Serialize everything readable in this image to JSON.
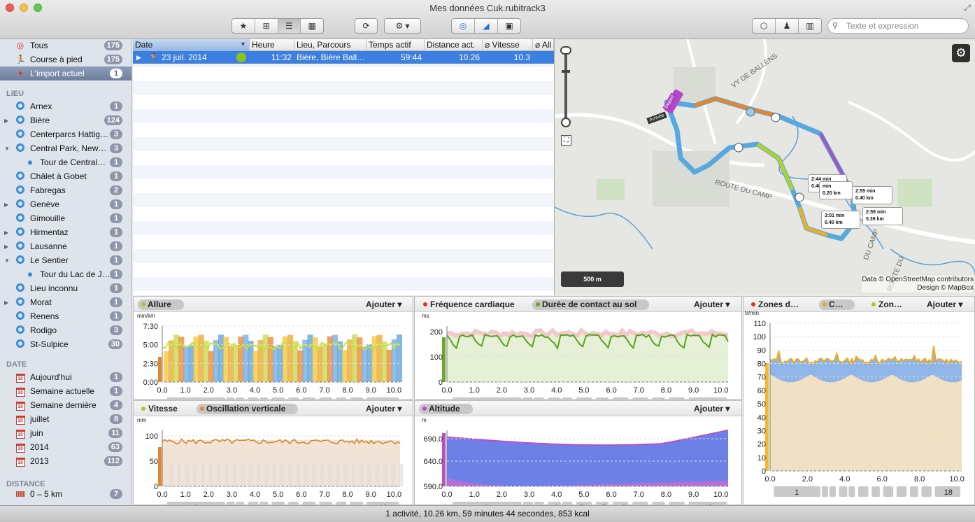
{
  "window": {
    "title": "Mes données Cuk.rubitrack3"
  },
  "toolbar": {
    "search_placeholder": "Texte et expression",
    "group1": [
      "★",
      "⊞",
      "☰",
      "▦"
    ],
    "group2": [
      "⟳"
    ],
    "group3": [
      "⚙ ▾"
    ],
    "group4": [
      "◎",
      "◢",
      "▣"
    ],
    "group5": [
      "⬡",
      "♟",
      "▥"
    ]
  },
  "sidebar": {
    "top": [
      {
        "label": "Tous",
        "count": "175",
        "icon": "◎",
        "color": "#e0342c"
      },
      {
        "label": "Course à pied",
        "count": "175",
        "icon": "🏃",
        "color": "#111"
      },
      {
        "label": "L'import actuel",
        "count": "1",
        "icon": "✦",
        "color": "#e0342c"
      }
    ],
    "lieu_header": "LIEU",
    "lieu": [
      {
        "label": "Arnex",
        "count": "1"
      },
      {
        "label": "Bière",
        "count": "124",
        "tri": "▶"
      },
      {
        "label": "Centerparcs Hattig…",
        "count": "3"
      },
      {
        "label": "Central Park, New…",
        "count": "3",
        "tri": "▼"
      },
      {
        "label": "Tour de Central…",
        "count": "1",
        "child": true
      },
      {
        "label": "Châlet à Gobet",
        "count": "1"
      },
      {
        "label": "Fabregas",
        "count": "2"
      },
      {
        "label": "Genève",
        "count": "1",
        "tri": "▶"
      },
      {
        "label": "Gimouille",
        "count": "1"
      },
      {
        "label": "Hirmentaz",
        "count": "1",
        "tri": "▶"
      },
      {
        "label": "Lausanne",
        "count": "1",
        "tri": "▶"
      },
      {
        "label": "Le Sentier",
        "count": "1",
        "tri": "▼"
      },
      {
        "label": "Tour du Lac de J…",
        "count": "1",
        "child": true
      },
      {
        "label": "Lieu inconnu",
        "count": "1"
      },
      {
        "label": "Morat",
        "count": "1",
        "tri": "▶"
      },
      {
        "label": "Renens",
        "count": "1"
      },
      {
        "label": "Rodigo",
        "count": "3"
      },
      {
        "label": "St-Sulpice",
        "count": "30"
      }
    ],
    "date_header": "DATE",
    "date": [
      {
        "label": "Aujourd'hui",
        "count": "1"
      },
      {
        "label": "Semaine actuelle",
        "count": "1"
      },
      {
        "label": "Semaine dernière",
        "count": "4"
      },
      {
        "label": "juillet",
        "count": "8"
      },
      {
        "label": "juin",
        "count": "11"
      },
      {
        "label": "2014",
        "count": "63"
      },
      {
        "label": "2013",
        "count": "112"
      }
    ],
    "distance_header": "DISTANCE",
    "distance": [
      {
        "label": "0 – 5 km",
        "count": "7"
      }
    ]
  },
  "table": {
    "columns": [
      "Date",
      "Heure",
      "Lieu, Parcours",
      "Temps actif",
      "Distance act.",
      "⌀ Vitesse",
      "⌀ All"
    ],
    "row": {
      "date": "23 juil. 2014",
      "heure": "11:32",
      "lieu": "Bière, Bière Ball…",
      "temps": "59:44",
      "distance": "10.26",
      "vitesse": "10.3"
    }
  },
  "map": {
    "labels": [
      "VY DE BALLENS",
      "ROUTE DU CAMP",
      "DU CAMP",
      "ROUTE DU"
    ],
    "start": "Départ",
    "end": "Arrivée",
    "scale": "500 m",
    "attrib1": "Data © OpenStreetMap contributors",
    "attrib2": "Design © MapBox",
    "splits": [
      {
        "t": "2:44 min",
        "d": "0.40 km"
      },
      {
        "t": "2:55 min",
        "d": "0.40 km"
      },
      {
        "t": "3:01 min",
        "d": "0.40 km"
      },
      {
        "t": "2:59 min",
        "d": "0.39 km"
      },
      {
        "t": "min",
        "d": "0.20 km"
      }
    ]
  },
  "panels": {
    "ajouter": "Ajouter ▾",
    "allure": {
      "title": "Allure",
      "unit": "min/km",
      "ticks": [
        "7:30",
        "5:00",
        "2:30",
        "0:00"
      ]
    },
    "fc": {
      "title": "Fréquence cardiaque",
      "title2": "Durée de contact au sol",
      "unit": "ms",
      "ticks": [
        "200",
        "100",
        "0"
      ]
    },
    "zones": {
      "title": "Zones d…",
      "title2": "C…",
      "title3": "Zon…",
      "unit": "tr/min",
      "ticks": [
        "110",
        "100",
        "90",
        "80",
        "70",
        "60",
        "50",
        "40",
        "30",
        "20",
        "10",
        "0"
      ]
    },
    "vitesse": {
      "title": "Vitesse",
      "title2": "Oscillation verticale",
      "unit": "mm",
      "ticks": [
        "100",
        "50",
        "0"
      ]
    },
    "altitude": {
      "title": "Altitude",
      "unit": "m",
      "ticks": [
        "690.0",
        "640.0",
        "590.0"
      ]
    },
    "x_km": [
      "0.0",
      "1.0",
      "2.0",
      "3.0",
      "4.0",
      "5.0",
      "6.0",
      "7.0",
      "8.0",
      "9.0",
      "10.0"
    ],
    "x_km2": [
      "0.0",
      "2.0",
      "4.0",
      "6.0",
      "8.0",
      "10.0"
    ],
    "laps": [
      "1",
      "18"
    ],
    "laps_mid": [
      "3",
      "5",
      "7",
      "9"
    ]
  },
  "status": "1 activité, 10.26 km, 59 minutes 44 secondes, 853 kcal"
}
